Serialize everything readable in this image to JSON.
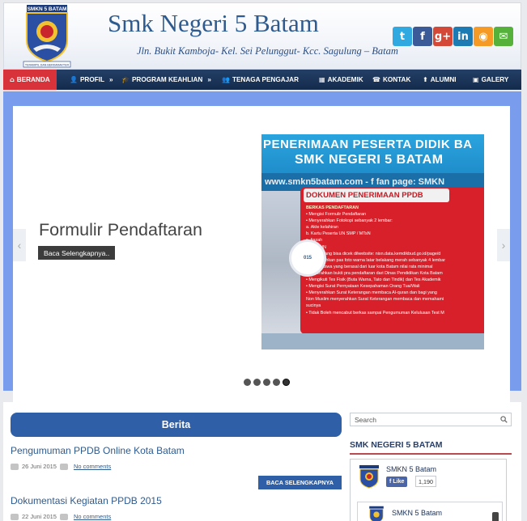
{
  "header": {
    "title": "Smk Negeri 5 Batam",
    "address": "Jln. Bukit Kamboja- Kel. Sei Pelunggut- Kcc. Sagulung – Batam",
    "logo_text": "SMKN 5 BATAM",
    "logo_motto": "TERAMPIL DAN BERKARAKTER",
    "social": [
      {
        "icon": "twitter-icon",
        "glyph": "t",
        "color": "#2fa9e0"
      },
      {
        "icon": "facebook-icon",
        "glyph": "f",
        "color": "#3b5a98"
      },
      {
        "icon": "google-plus-icon",
        "glyph": "g+",
        "color": "#d34836"
      },
      {
        "icon": "linkedin-icon",
        "glyph": "in",
        "color": "#1d7bb4"
      },
      {
        "icon": "rss-icon",
        "glyph": "◉",
        "color": "#f59a24"
      },
      {
        "icon": "email-icon",
        "glyph": "✉",
        "color": "#55b13a"
      }
    ]
  },
  "nav": {
    "items": [
      {
        "label": "BERANDA",
        "icon": "home-icon",
        "glyph": "⌂",
        "active": true
      },
      {
        "label": "PROFIL",
        "icon": "user-icon",
        "glyph": "👤",
        "arrow": "»"
      },
      {
        "label": "PROGRAM KEAHLIAN",
        "icon": "graduation-cap-icon",
        "glyph": "🎓",
        "arrow": "»"
      },
      {
        "label": "TENAGA PENGAJAR",
        "icon": "users-icon",
        "glyph": "👥"
      },
      {
        "label": "AKADEMIK",
        "icon": "building-icon",
        "glyph": "▦"
      },
      {
        "label": "KONTAK",
        "icon": "phone-icon",
        "glyph": "☎"
      },
      {
        "label": "ALUMNI",
        "icon": "upload-icon",
        "glyph": "⬆"
      },
      {
        "label": "GALERY",
        "icon": "image-icon",
        "glyph": "▣"
      }
    ]
  },
  "slider": {
    "title": "Formulir Pendaftaran",
    "button": "Baca Selengkapnya..",
    "prev": "‹",
    "next": "›",
    "dots": 5,
    "active_dot": 4
  },
  "poster": {
    "heading1": "PENERIMAAN PESERTA DIDIK BA",
    "heading2": "SMK NEGERI 5 BATAM",
    "web": "www.smkn5batam.com - f fan page: SMKN",
    "panel_title": "DOKUMEN PENERIMAAN PPDB",
    "year_label": "015",
    "lines": [
      "BERKAS PENDAFTARAN",
      "• Mengisi Formulir Pendaftaran",
      "• Menyerahkan Fotokopi sebanyak 2 lembar:",
      "a. Akte kelahiran",
      "b. Kartu Peserta UN SMP / MTsN",
      "c. Ijazah",
      "d. SKHUN",
      "e. NISN yang bisa dicek dilwebsite: nisn.data.kemdikbud.go.id/page/d",
      "• Menyerahkan pas foto warna latar belakang merah sebanyak 4 lembar",
      "• Calon siswa yang berasal dari luar kota Batam nilai rata minimal",
      "  menyerahkan bukti pra pendaftaran dari Dinas Pendidikan Kota Batam",
      "• Mengikuti Tes Fisik (Buta Warna, Tato dan Tindik) dan Tes Akademik",
      "• Mengisi Surat Pernyataan Kesepahaman Orang Tua/Wali",
      "• Menyerahkan Surat Keterangan membaca Al-quran dan bagi yang",
      "  Non Muslim menyerahkan Surat Keterangan membaca dan memahami",
      "  sucinya",
      "• Tidak Boleh mencabut berkas sampai Pengumuman Kelulusan Test M"
    ]
  },
  "main": {
    "section_title": "Berita",
    "posts": [
      {
        "title": "Pengumuman PPDB Online Kota Batam",
        "date": "26 Juni 2015",
        "comments": "No comments",
        "read_more": "BACA SELENGKAPNYA"
      },
      {
        "title": "Dokumentasi Kegiatan PPDB 2015",
        "date": "22 Juni 2015",
        "comments": "No comments"
      }
    ]
  },
  "sidebar": {
    "search_placeholder": "Search",
    "title": "SMK NEGERI 5 BATAM",
    "fb_name": "SMKN 5 Batam",
    "fb_like": "Like",
    "fb_count": "1,190",
    "fb_name2": "SMKN 5 Batam"
  }
}
